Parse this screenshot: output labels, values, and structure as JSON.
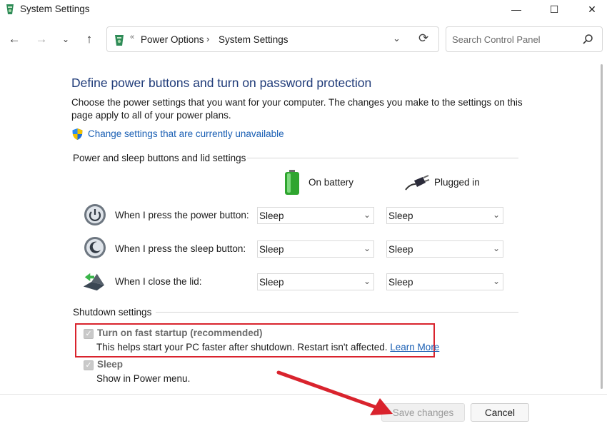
{
  "window": {
    "title": "System Settings",
    "min_glyph": "—",
    "max_glyph": "☐",
    "close_glyph": "✕"
  },
  "nav": {
    "back_glyph": "←",
    "forward_glyph": "→",
    "history_glyph": "⌄",
    "up_glyph": "↑"
  },
  "address": {
    "sep_glyph": "«",
    "crumbs": [
      "Power Options",
      "System Settings"
    ],
    "chevron_glyph": "›",
    "dropdown_glyph": "⌄",
    "refresh_glyph": "⟳"
  },
  "search": {
    "placeholder": "Search Control Panel"
  },
  "content": {
    "title": "Define power buttons and turn on password protection",
    "intro": "Choose the power settings that you want for your computer. The changes you make to the settings on this page apply to all of your power plans.",
    "change_link": "Change settings that are currently unavailable"
  },
  "power_group": {
    "title": "Power and sleep buttons and lid settings",
    "col_battery": "On battery",
    "col_plugged": "Plugged in",
    "rows": [
      {
        "label": "When I press the power button:",
        "battery": "Sleep",
        "plugged": "Sleep"
      },
      {
        "label": "When I press the sleep button:",
        "battery": "Sleep",
        "plugged": "Sleep"
      },
      {
        "label": "When I close the lid:",
        "battery": "Sleep",
        "plugged": "Sleep"
      }
    ],
    "select_arrow": "⌄"
  },
  "shutdown_group": {
    "title": "Shutdown settings",
    "fast_startup": {
      "label": "Turn on fast startup (recommended)",
      "desc": "This helps start your PC faster after shutdown. Restart isn't affected.",
      "link": "Learn More",
      "checked": true
    },
    "sleep": {
      "label": "Sleep",
      "desc": "Show in Power menu.",
      "checked": true
    },
    "check_glyph": "✓"
  },
  "buttons": {
    "save": "Save changes",
    "cancel": "Cancel"
  },
  "colors": {
    "title_blue": "#1e3a78",
    "link_blue": "#1a5fb4",
    "highlight_red": "#d9232d"
  }
}
